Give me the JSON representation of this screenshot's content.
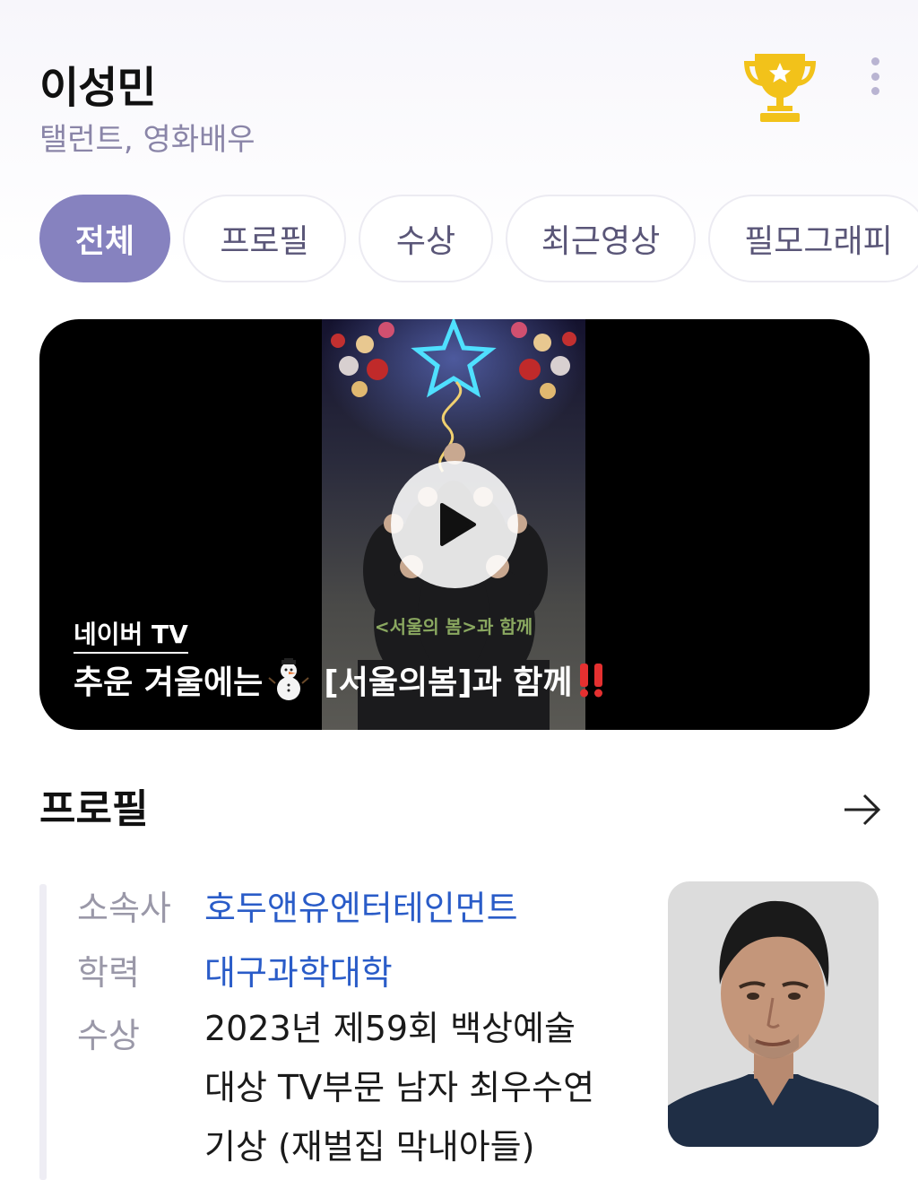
{
  "header": {
    "name": "이성민",
    "subtitle": "탤런트, 영화배우",
    "trophy_icon": "trophy-icon",
    "more_icon": "more-vertical-icon"
  },
  "tabs": [
    {
      "label": "전체",
      "active": true
    },
    {
      "label": "프로필",
      "active": false
    },
    {
      "label": "수상",
      "active": false
    },
    {
      "label": "최근영상",
      "active": false
    },
    {
      "label": "필모그래피",
      "active": false
    }
  ],
  "video": {
    "source": "네이버 TV",
    "title_part1": "추운 겨울에는",
    "title_part2": "[서울의봄]과 함께",
    "thumbnail_caption": "<서울의 봄>과 함께",
    "play_icon": "play-icon"
  },
  "profile": {
    "section_title": "프로필",
    "arrow_icon": "arrow-right-icon",
    "rows": [
      {
        "label": "소속사",
        "value": "호두앤유엔터테인먼트",
        "link": true
      },
      {
        "label": "학력",
        "value": "대구과학대학",
        "link": true
      },
      {
        "label": "수상",
        "value_lines": [
          "2023년 제59회 백상예술",
          "대상 TV부문 남자 최우수연",
          "기상 (재벌집 막내아들)"
        ],
        "link": false
      }
    ]
  },
  "colors": {
    "accent": "#8682bf",
    "link": "#2a5cc8",
    "trophy": "#f2c21a"
  }
}
